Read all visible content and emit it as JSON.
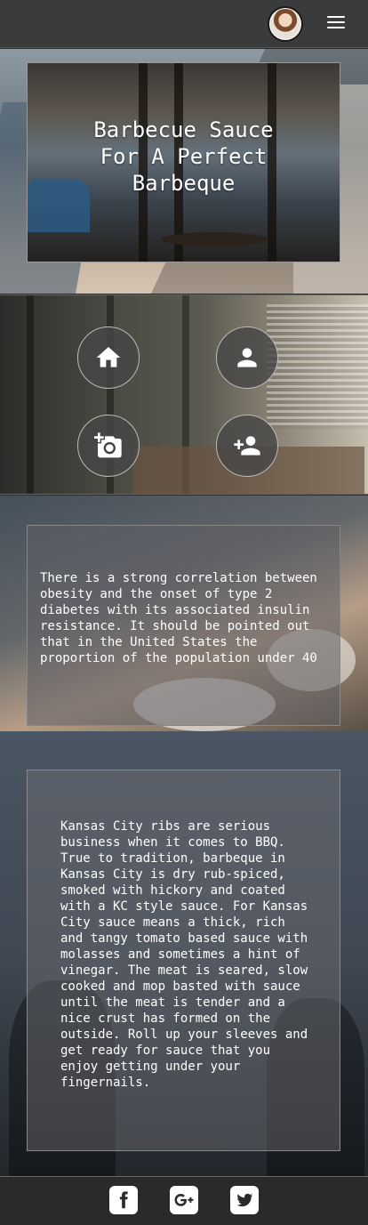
{
  "header": {
    "avatar_alt": "avatar",
    "menu_icon": "hamburger-menu-icon"
  },
  "hero": {
    "title": "Barbecue Sauce\nFor A Perfect\nBarbeque"
  },
  "nav": {
    "items": [
      {
        "icon": "home-icon"
      },
      {
        "icon": "user-icon"
      },
      {
        "icon": "add-photo-icon"
      },
      {
        "icon": "add-user-icon"
      }
    ]
  },
  "cards": {
    "card1_text": "There is a strong correlation between obesity and the onset of type 2 diabetes with its associated insulin resistance. It should be pointed out that in the United States the proportion of the population under 40",
    "card2_text": "Kansas City ribs are serious business when it comes to BBQ. True to tradition, barbeque in Kansas City is dry rub-spiced, smoked with hickory and coated with a KC style sauce. For Kansas City sauce means a thick, rich and tangy tomato based sauce with molasses and sometimes a hint of vinegar. The meat is seared, slow cooked and mop basted with sauce until the meat is tender and a nice crust has formed on the outside. Roll up your sleeves and get ready for sauce that you enjoy getting under your fingernails."
  },
  "footer": {
    "social": [
      {
        "icon": "facebook-icon"
      },
      {
        "icon": "google-plus-icon"
      },
      {
        "icon": "twitter-icon"
      }
    ]
  }
}
